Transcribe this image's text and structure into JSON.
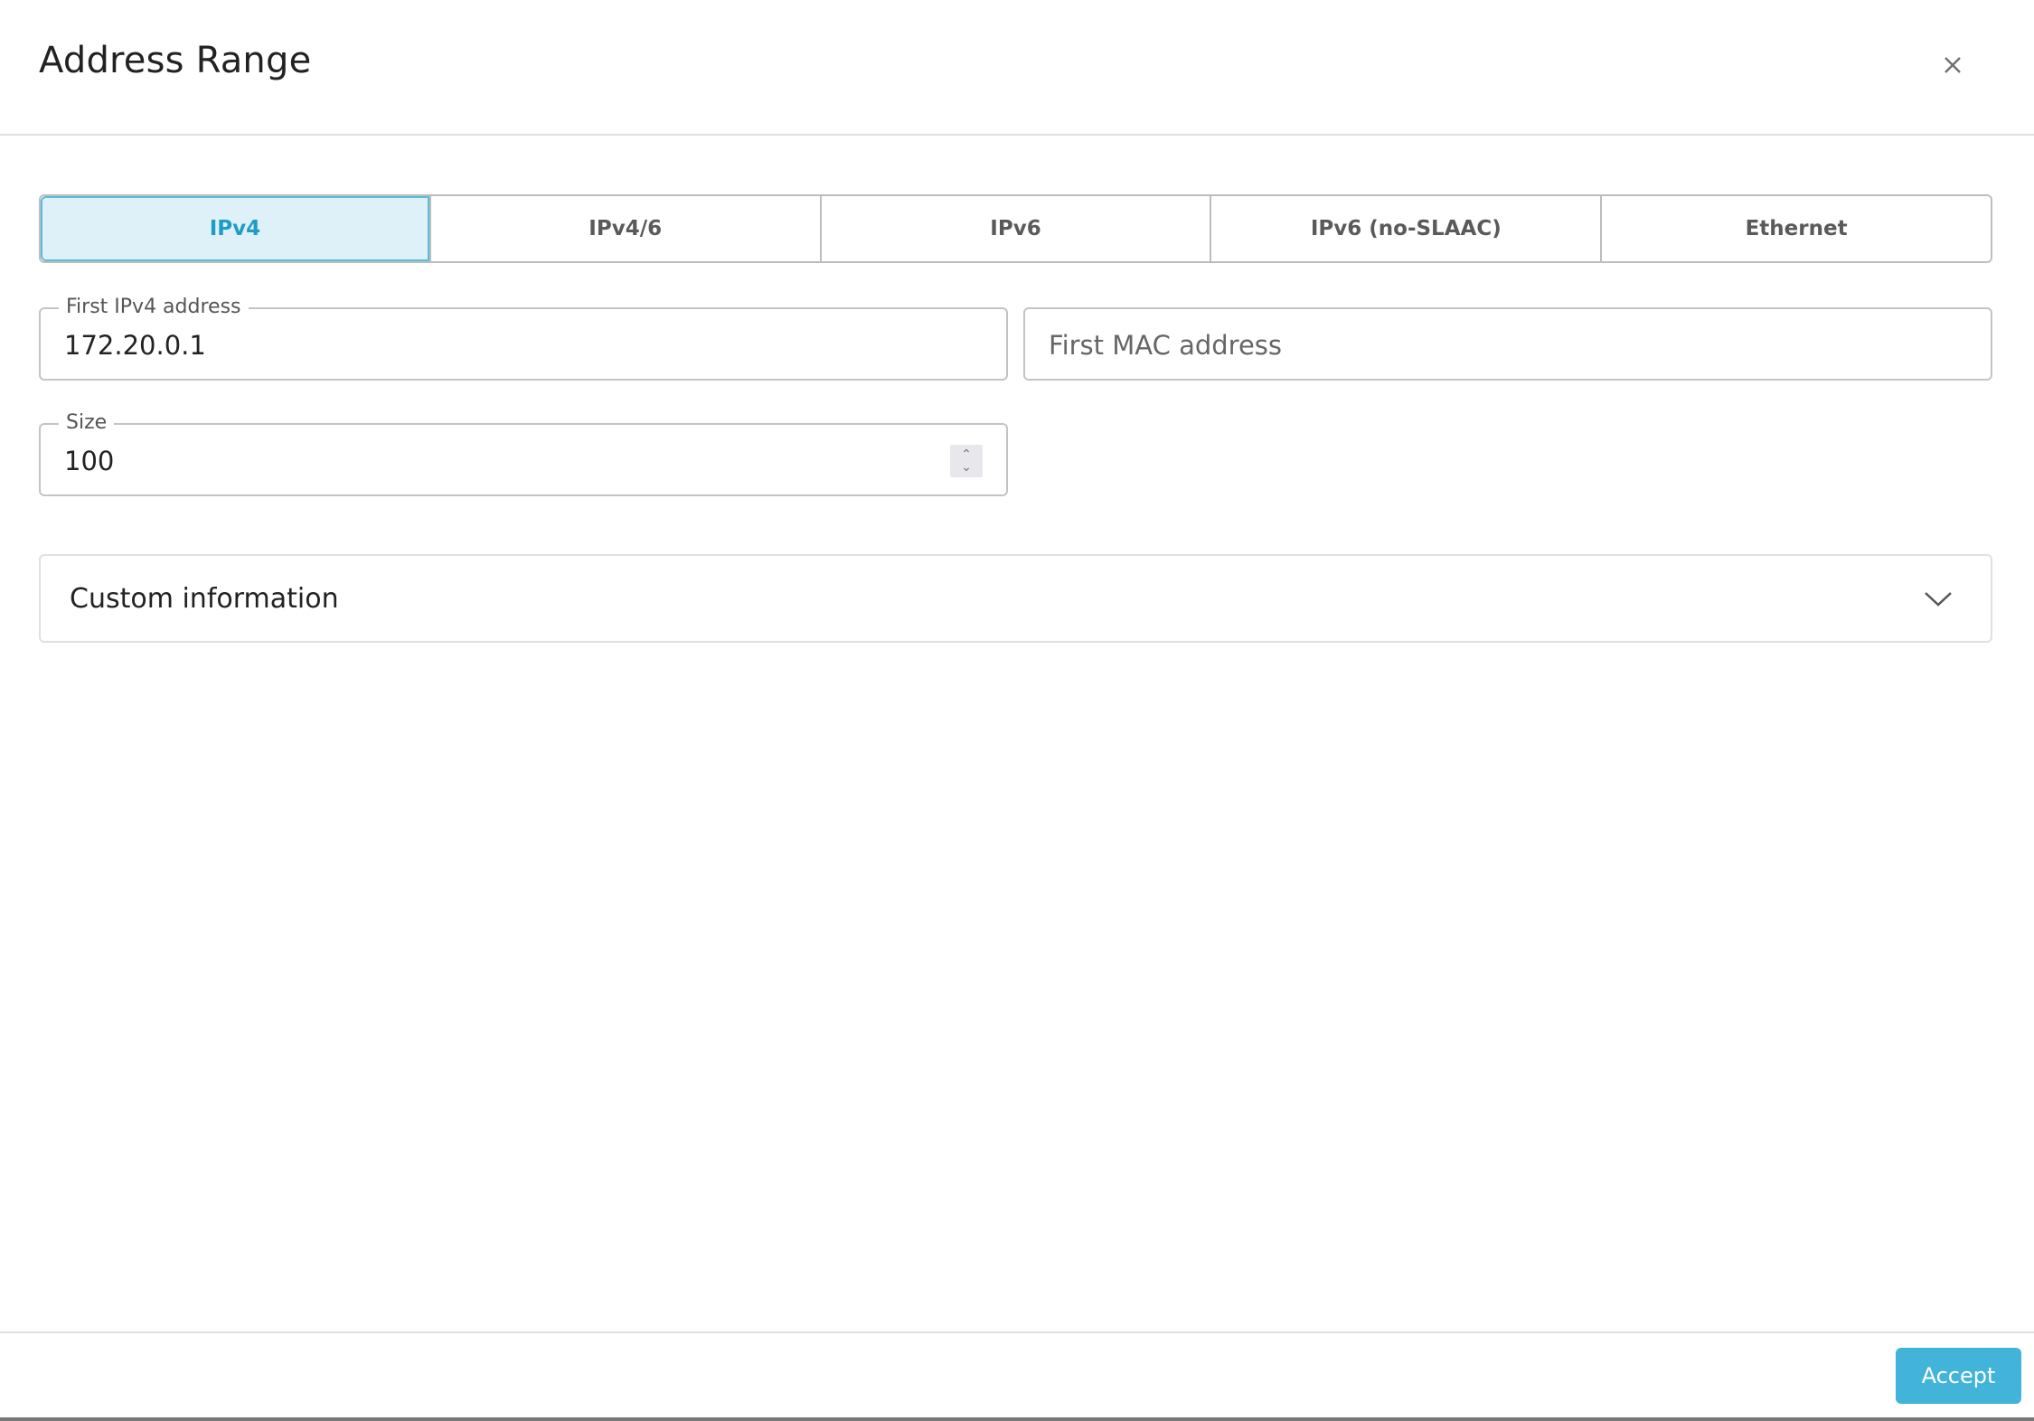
{
  "dialog": {
    "title": "Address Range",
    "close_icon": "close-icon"
  },
  "tabs": [
    {
      "label": "IPv4",
      "active": true
    },
    {
      "label": "IPv4/6",
      "active": false
    },
    {
      "label": "IPv6",
      "active": false
    },
    {
      "label": "IPv6 (no-SLAAC)",
      "active": false
    },
    {
      "label": "Ethernet",
      "active": false
    }
  ],
  "fields": {
    "first_ipv4": {
      "label": "First IPv4 address",
      "value": "172.20.0.1"
    },
    "first_mac": {
      "placeholder": "First MAC address",
      "value": ""
    },
    "size": {
      "label": "Size",
      "value": "100"
    }
  },
  "accordion": {
    "label": "Custom information",
    "expanded": false,
    "icon": "chevron-down-icon"
  },
  "footer": {
    "accept_label": "Accept"
  },
  "colors": {
    "accent": "#42b4d9",
    "active_tab_bg": "#dff1f8",
    "active_tab_text": "#1e9cc6"
  }
}
